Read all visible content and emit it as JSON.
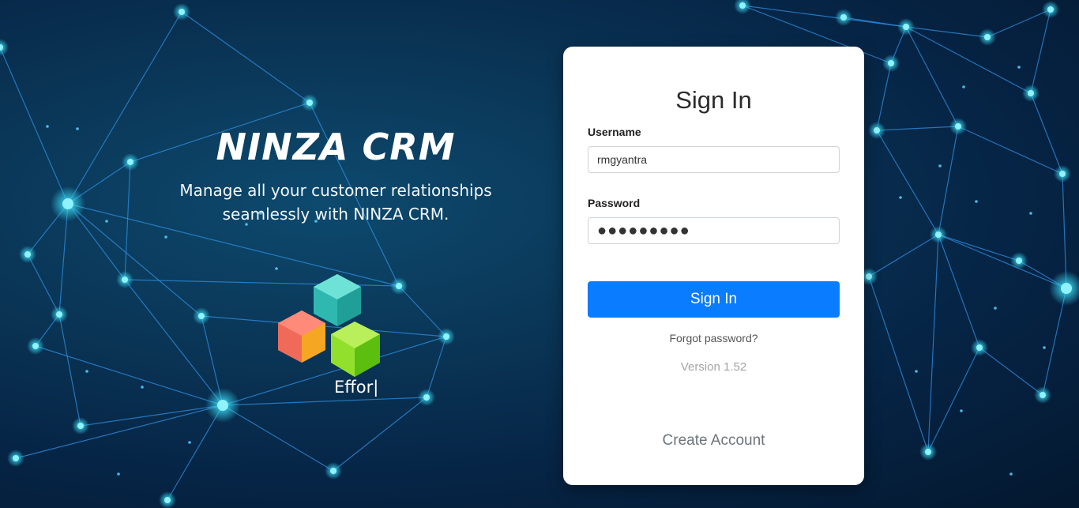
{
  "brand": {
    "title": "NINZA CRM",
    "tagline_line1": "Manage all your customer relationships",
    "tagline_line2": "seamlessly with NINZA CRM.",
    "logo_icon": "cubes-logo-icon",
    "logo_text": "Effor|"
  },
  "login": {
    "title": "Sign In",
    "username_label": "Username",
    "username_value": "rmgyantra",
    "password_label": "Password",
    "password_value": "●●●●●●●●●",
    "signin_label": "Sign In",
    "forgot_label": "Forgot password?",
    "version": "Version 1.52",
    "create_account_label": "Create Account"
  },
  "colors": {
    "accent": "#0a7cff",
    "background": "#062445",
    "network_line": "#2f8fe0",
    "network_node": "#4fe3ff"
  }
}
